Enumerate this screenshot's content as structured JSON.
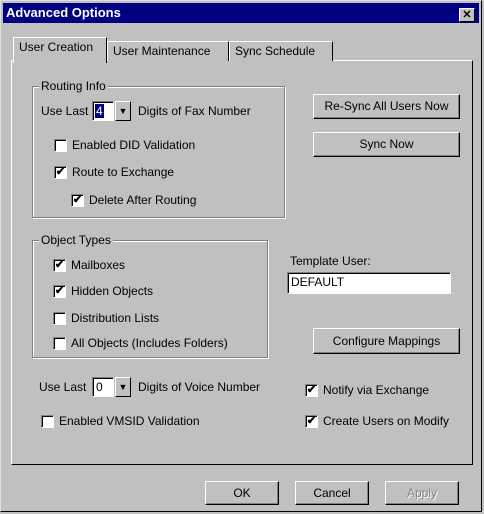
{
  "window": {
    "title": "Advanced Options",
    "close_glyph": "✕"
  },
  "tabs": [
    {
      "label": "User Creation",
      "active": true
    },
    {
      "label": "User Maintenance",
      "active": false
    },
    {
      "label": "Sync Schedule",
      "active": false
    }
  ],
  "routing_info": {
    "label": "Routing Info",
    "use_last_prefix": "Use Last",
    "digits_value": "4",
    "digits_suffix": "Digits of Fax Number",
    "enabled_did": {
      "label": "Enabled DID Validation",
      "checked": false
    },
    "route_to_exchange": {
      "label": "Route to Exchange",
      "checked": true
    },
    "delete_after_routing": {
      "label": "Delete After Routing",
      "checked": true
    }
  },
  "buttons": {
    "resync_all": "Re-Sync All Users Now",
    "sync_now": "Sync Now",
    "configure_mappings": "Configure Mappings",
    "ok": "OK",
    "cancel": "Cancel",
    "apply": "Apply"
  },
  "object_types": {
    "label": "Object Types",
    "mailboxes": {
      "label": "Mailboxes",
      "checked": true
    },
    "hidden_objects": {
      "label": "Hidden Objects",
      "checked": true
    },
    "distribution_lists": {
      "label": "Distribution Lists",
      "checked": false
    },
    "all_objects": {
      "label": "All Objects (Includes Folders)",
      "checked": false
    }
  },
  "template_user": {
    "label": "Template User:",
    "value": "DEFAULT"
  },
  "voice": {
    "use_last_prefix": "Use Last",
    "digits_value": "0",
    "digits_suffix": "Digits of Voice Number",
    "enabled_vmsid": {
      "label": "Enabled VMSID Validation",
      "checked": false
    }
  },
  "notify_via_exchange": {
    "label": "Notify via Exchange",
    "checked": true
  },
  "create_users_on_modify": {
    "label": "Create Users on Modify",
    "checked": true
  },
  "glyphs": {
    "check": "✔",
    "dropdown": "▼"
  }
}
